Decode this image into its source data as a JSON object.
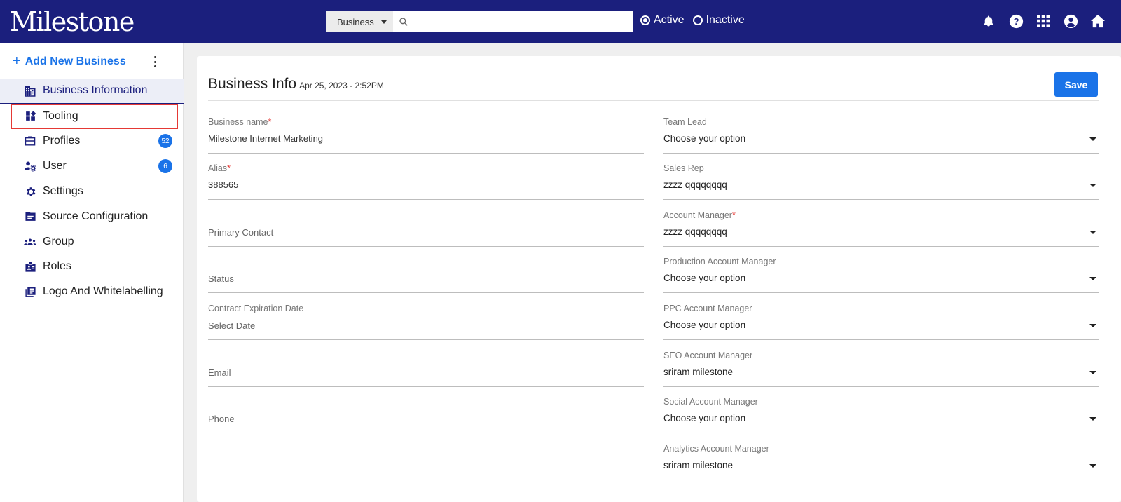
{
  "app": {
    "logo_text": "Milestone"
  },
  "header": {
    "search_type": "Business",
    "search_placeholder": "",
    "status_options": [
      {
        "label": "Active",
        "selected": true
      },
      {
        "label": "Inactive",
        "selected": false
      }
    ],
    "icons": [
      "bell-icon",
      "help-icon",
      "apps-grid-icon",
      "account-icon",
      "home-icon"
    ]
  },
  "sidebar": {
    "add_label": "Add New Business",
    "items": [
      {
        "label": "Business Information",
        "icon": "building-icon",
        "active": true
      },
      {
        "label": "Tooling",
        "icon": "dashboard-icon",
        "highlighted": true
      },
      {
        "label": "Profiles",
        "icon": "briefcase-icon",
        "badge": "52"
      },
      {
        "label": "User",
        "icon": "user-settings-icon",
        "badge": "6"
      },
      {
        "label": "Settings",
        "icon": "gear-icon"
      },
      {
        "label": "Source Configuration",
        "icon": "folder-icon"
      },
      {
        "label": "Group",
        "icon": "group-icon"
      },
      {
        "label": "Roles",
        "icon": "badge-icon"
      },
      {
        "label": "Logo And Whitelabelling",
        "icon": "library-icon"
      }
    ]
  },
  "page": {
    "title": "Business Info",
    "timestamp": "Apr 25, 2023 - 2:52PM",
    "save_label": "Save"
  },
  "left_fields": [
    {
      "label": "Business name",
      "required": "*",
      "value": "Milestone Internet Marketing"
    },
    {
      "label": "Alias",
      "required": "*",
      "value": "388565"
    },
    {
      "placeholder": "Primary Contact"
    },
    {
      "placeholder": "Status"
    },
    {
      "label": "Contract Expiration Date",
      "placeholder": "Select Date"
    },
    {
      "placeholder": "Email"
    },
    {
      "placeholder": "Phone"
    }
  ],
  "right_fields": [
    {
      "label": "Team Lead",
      "value": "Choose your option"
    },
    {
      "label": "Sales Rep",
      "value": "zzzz qqqqqqqq"
    },
    {
      "label": "Account Manager",
      "required": "*",
      "value": "zzzz qqqqqqqq"
    },
    {
      "label": "Production Account Manager",
      "value": "Choose your option"
    },
    {
      "label": "PPC Account Manager",
      "value": "Choose your option"
    },
    {
      "label": "SEO Account Manager",
      "value": "sriram milestone"
    },
    {
      "label": "Social Account Manager",
      "value": "Choose your option"
    },
    {
      "label": "Analytics Account Manager",
      "value": "sriram milestone"
    }
  ]
}
